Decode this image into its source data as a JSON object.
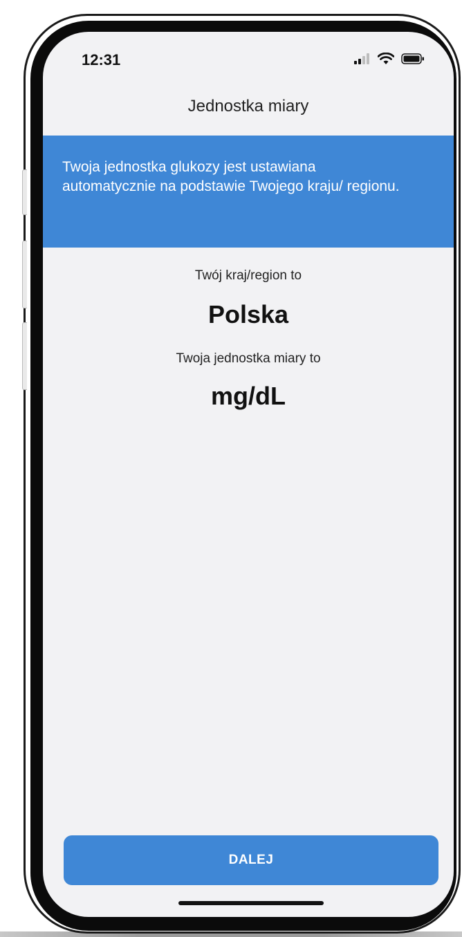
{
  "status_bar": {
    "time": "12:31",
    "icons": [
      "cellular-signal-icon",
      "wifi-icon",
      "battery-icon"
    ]
  },
  "nav": {
    "title": "Jednostka miary"
  },
  "banner": {
    "text": "Twoja jednostka glukozy jest ustawiana automatycznie na podstawie Twojego kraju/ regionu.",
    "background_color": "#3f87d6"
  },
  "content": {
    "country_label": "Twój kraj/region to",
    "country_value": "Polska",
    "unit_label": "Twoja jednostka miary to",
    "unit_value": "mg/dL"
  },
  "actions": {
    "next_label": "DALEJ"
  },
  "colors": {
    "accent": "#3f87d6",
    "screen_background": "#f2f2f4"
  }
}
